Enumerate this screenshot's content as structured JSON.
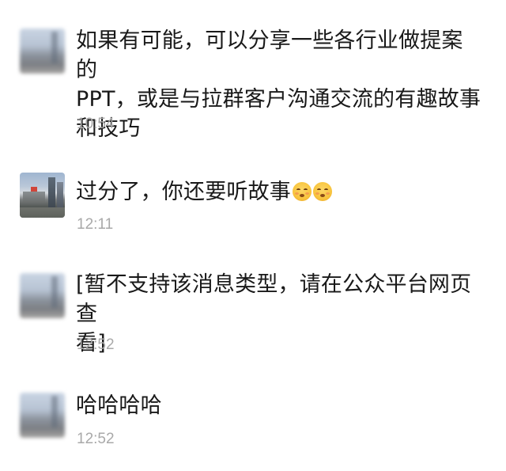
{
  "messages": [
    {
      "text": "如果有可能，可以分享一些各行业做提案的PPT，或是与拉群客户沟通交流的有趣故事和技巧",
      "line1": "如果有可能，可以分享一些各行业做提案的",
      "line2": "PPT，或是与拉群客户沟通交流的有趣故事",
      "line3": "和技巧",
      "time": "10:54",
      "avatar": "blurred-avatar"
    },
    {
      "text": "过分了，你还要听故事",
      "emojis": [
        "smirk-face-emoji",
        "smirk-face-emoji"
      ],
      "time": "12:11",
      "avatar": "city-street-avatar"
    },
    {
      "text": "[暂不支持该消息类型，请在公众平台网页查看]",
      "line1": "[暂不支持该消息类型，请在公众平台网页查",
      "line2": "看]",
      "time": "12:52",
      "avatar": "blurred-avatar"
    },
    {
      "text": "哈哈哈哈",
      "time": "12:52",
      "avatar": "blurred-avatar"
    }
  ],
  "colors": {
    "background": "#ffffff",
    "message_text": "#191919",
    "timestamp": "#a9a9a9"
  }
}
